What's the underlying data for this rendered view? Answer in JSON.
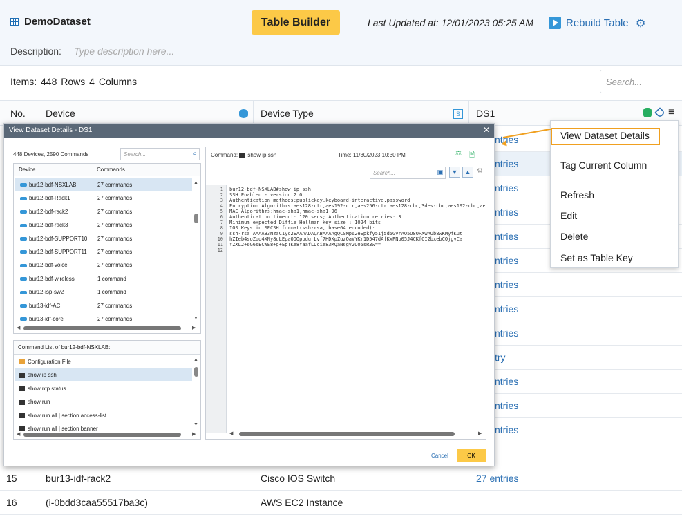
{
  "header": {
    "dataset_name": "DemoDataset",
    "table_builder_label": "Table Builder",
    "last_updated": "Last Updated at: 12/01/2023 05:25 AM",
    "rebuild_label": "Rebuild Table",
    "description_label": "Description:",
    "description_placeholder": "Type description here..."
  },
  "summary": {
    "items_label": "Items:",
    "rows": "448 Rows",
    "columns": "4 Columns",
    "search_placeholder": "Search..."
  },
  "table": {
    "headers": [
      "No.",
      "Device",
      "Device Type",
      "DS1"
    ],
    "right_cells": [
      "ntries",
      "ntries",
      "ntries",
      "ntries",
      "ntries",
      "ntries",
      "ntries",
      "ntries",
      "ntries",
      "try",
      "ntries",
      "ntries",
      "ntries"
    ],
    "rows": [
      {
        "no": "15",
        "device": "bur13-idf-rack2",
        "type": "Cisco IOS Switch",
        "ds1": "27 entries"
      },
      {
        "no": "16",
        "device": "(i-0bdd3caa55517ba3c)",
        "type": "AWS EC2 Instance",
        "ds1": ""
      }
    ]
  },
  "modal": {
    "title": "View Dataset Details - DS1",
    "summary": "448 Devices, 2590 Commands",
    "search_placeholder": "Search...",
    "device_col": "Device",
    "commands_col": "Commands",
    "devices": [
      {
        "name": "bur12-bdf-NSXLAB",
        "commands": "27 commands"
      },
      {
        "name": "bur12-bdf-Rack1",
        "commands": "27 commands"
      },
      {
        "name": "bur12-bdf-rack2",
        "commands": "27 commands"
      },
      {
        "name": "bur12-bdf-rack3",
        "commands": "27 commands"
      },
      {
        "name": "bur12-bdf-SUPPORT10",
        "commands": "27 commands"
      },
      {
        "name": "bur12-bdf-SUPPORT11",
        "commands": "27 commands"
      },
      {
        "name": "bur12-bdf-voice",
        "commands": "27 commands"
      },
      {
        "name": "bur12-bdf-wireless",
        "commands": "1 command"
      },
      {
        "name": "bur12-isp-sw2",
        "commands": "1 command"
      },
      {
        "name": "bur13-idf-ACI",
        "commands": "27 commands"
      },
      {
        "name": "bur13-idf-core",
        "commands": "27 commands"
      }
    ],
    "command_list_title": "Command List of bur12-bdf-NSXLAB:",
    "commands": [
      "Configuration File",
      "show ip ssh",
      "show ntp status",
      "show run",
      "show run all | section access-list",
      "show run all | section banner"
    ],
    "command_label": "Command:",
    "command_value": "show ip ssh",
    "time_label": "Time:",
    "time_value": "11/30/2023 10:30 PM",
    "code_search_placeholder": "Search...",
    "line_numbers": "1\n2\n3\n4\n5\n6\n7\n8\n9\n10\n11\n12",
    "code": "bur12-bdf-NSXLAB#show ip ssh\nSSH Enabled - version 2.0\nAuthentication methods:publickey,keyboard-interactive,password\nEncryption Algorithms:aes128-ctr,aes192-ctr,aes256-ctr,aes128-cbc,3des-cbc,aes192-cbc,ae\nMAC Algorithms:hmac-sha1,hmac-sha1-96\nAuthentication timeout: 120 secs; Authentication retries: 3\nMinimum expected Diffie Hellman key size : 1024 bits\nIOS Keys in SECSH format(ssh-rsa, base64 encoded):\nssh-rsa AAAAB3NzaC1yc2EAAAADAQABAAAAgQCSMp62eEpkfy51j5d5GvrAO5O8OPXwAUb8wKMyfKut\nhZIeb4soZud4XNy8uLEpaODQpbdurLvf7HDXpZuzQaVYKr1D547dAfKxPNp05J4CKfCI2bxebCQjgvCa\nYZXL2+6G6sECWE8+g+EpTKe8YaafLDcie83MQaN6gV2U05sR3w==\n",
    "cancel_label": "Cancel",
    "ok_label": "OK"
  },
  "context_menu": {
    "items": [
      "View Dataset Details",
      "Tag Current Column",
      "Refresh",
      "Edit",
      "Delete",
      "Set as Table Key"
    ]
  }
}
